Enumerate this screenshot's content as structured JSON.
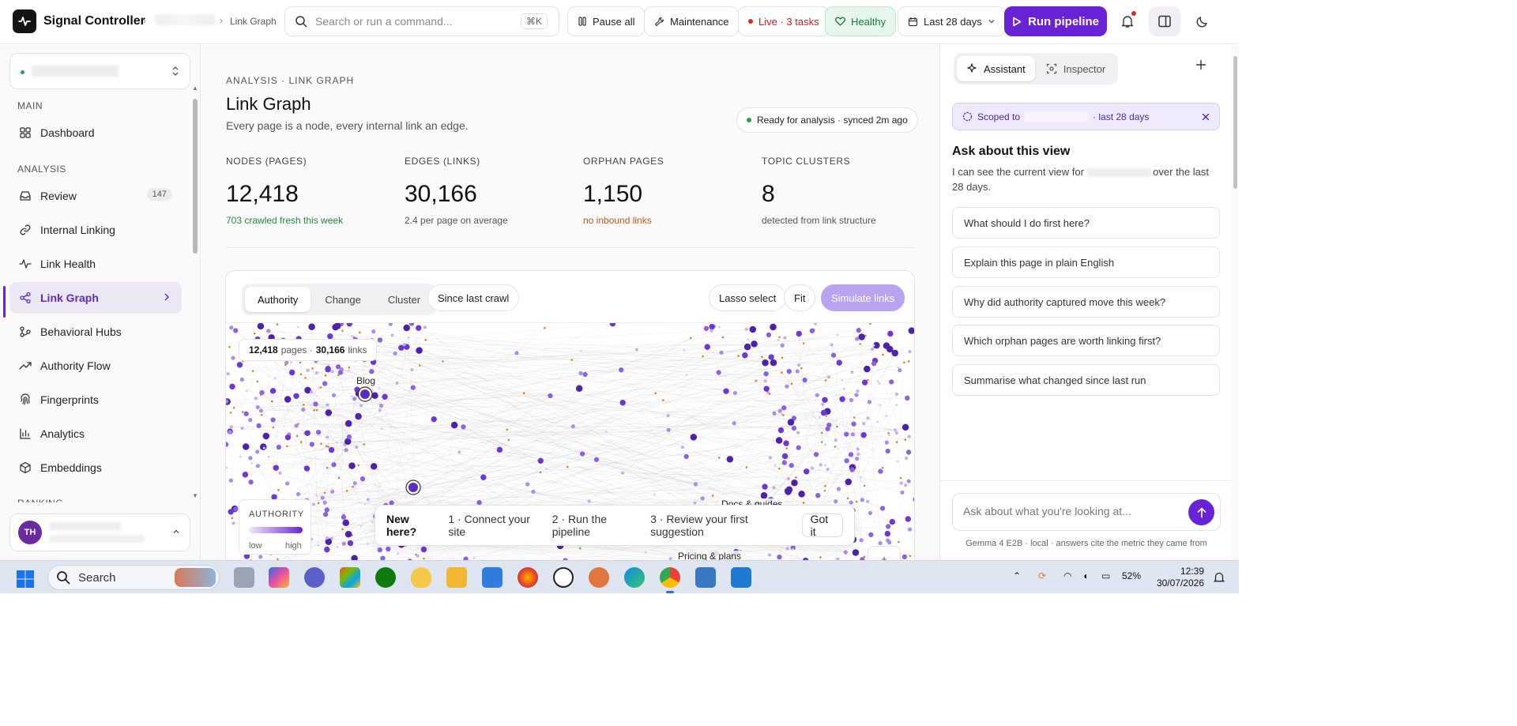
{
  "app": {
    "title": "Signal Controller",
    "breadcrumb_current": "Link Graph"
  },
  "topbar": {
    "search_placeholder": "Search or run a command...",
    "search_shortcut": "⌘K",
    "pause_label": "Pause all",
    "maintenance_label": "Maintenance",
    "live_label": "Live · 3 tasks",
    "health_label": "Healthy",
    "date_range_label": "Last 28 days",
    "run_label": "Run pipeline"
  },
  "sidebar": {
    "main_label": "MAIN",
    "analysis_label": "ANALYSIS",
    "ranking_label": "RANKING",
    "items": [
      {
        "label": "Dashboard",
        "icon": "grid-icon"
      },
      {
        "label": "Review",
        "icon": "inbox-icon",
        "badge": "147"
      },
      {
        "label": "Internal Linking",
        "icon": "link-icon"
      },
      {
        "label": "Link Health",
        "icon": "pulse-icon"
      },
      {
        "label": "Link Graph",
        "icon": "share-icon",
        "active": true
      },
      {
        "label": "Behavioral Hubs",
        "icon": "hub-icon"
      },
      {
        "label": "Authority Flow",
        "icon": "trend-icon"
      },
      {
        "label": "Fingerprints",
        "icon": "fingerprint-icon"
      },
      {
        "label": "Analytics",
        "icon": "bar-chart-icon"
      },
      {
        "label": "Embeddings",
        "icon": "cube-icon"
      }
    ],
    "user_initials": "TH"
  },
  "main": {
    "eyebrow": "ANALYSIS · LINK GRAPH",
    "title": "Link Graph",
    "subtitle": "Every page is a node, every internal link an edge.",
    "status": "Ready for analysis · synced 2m ago",
    "stats": [
      {
        "label": "NODES (PAGES)",
        "value": "12,418",
        "note": "703 crawled fresh this week",
        "note_color": "#1f8a45"
      },
      {
        "label": "EDGES (LINKS)",
        "value": "30,166",
        "note": "2.4 per page on average",
        "note_color": "#555555"
      },
      {
        "label": "ORPHAN PAGES",
        "value": "1,150",
        "note": "no inbound links",
        "note_color": "#c2571a"
      },
      {
        "label": "TOPIC CLUSTERS",
        "value": "8",
        "note": "detected from link structure",
        "note_color": "#555555"
      }
    ],
    "graph": {
      "modes": [
        "Authority",
        "Change",
        "Cluster"
      ],
      "active_mode": "Authority",
      "since_label": "Since last crawl",
      "lasso_label": "Lasso select",
      "fit_label": "Fit",
      "simulate_label": "Simulate links",
      "pages_count": "12,418",
      "pages_word": "pages ·",
      "links_count": "30,166",
      "links_word": "links",
      "node_labels": [
        "Blog",
        "Docs & guides",
        "Pricing & plans"
      ],
      "legend_title": "AUTHORITY",
      "legend_low": "low",
      "legend_high": "high",
      "zoom_in": "+"
    },
    "onboarding": {
      "title": "New here?",
      "steps": [
        "1 · Connect your site",
        "2 · Run the pipeline",
        "3 · Review your first suggestion"
      ],
      "dismiss": "Got it"
    }
  },
  "assistant": {
    "tabs": [
      "Assistant",
      "Inspector"
    ],
    "scope_prefix": "Scoped to",
    "scope_suffix": "· last 28 days",
    "heading": "Ask about this view",
    "intro_prefix": "I can see the current view for",
    "intro_suffix": "over the last 28 days.",
    "suggestions": [
      "What should I do first here?",
      "Explain this page in plain English",
      "Why did authority captured move this week?",
      "Which orphan pages are worth linking first?",
      "Summarise what changed since last run"
    ],
    "input_placeholder": "Ask about what you're looking at...",
    "footnote": "Gemma 4 E2B · local · answers cite the metric they came from"
  },
  "taskbar": {
    "search_label": "Search",
    "battery": "52%",
    "time": "12:39",
    "date": "30/07/2026"
  },
  "colors": {
    "accent": "#6a22d6",
    "healthy": "#1b7a3e",
    "live": "#d42a2a",
    "orphan": "#c2571a"
  }
}
